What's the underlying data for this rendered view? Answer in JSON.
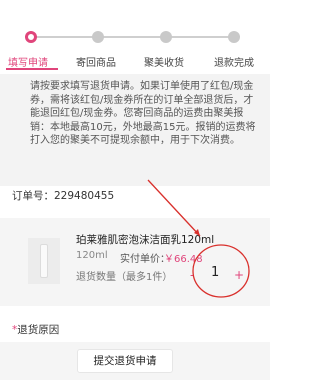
{
  "steps": [
    {
      "label": "填写申请",
      "active": true
    },
    {
      "label": "寄回商品",
      "active": false
    },
    {
      "label": "聚美收货",
      "active": false
    },
    {
      "label": "退款完成",
      "active": false
    }
  ],
  "notice": {
    "text": "请按要求填写退货申请。如果订单使用了红包/现金券，需将该红包/现金券所在的订单全部退货后，才能退回红包/现金券。您寄回商品的运费由聚美报销：本地最高10元，外地最高15元。报销的运费将打入您的聚美不可提现余额中，用于下次消费。"
  },
  "order": {
    "label": "订单号：",
    "number": "229480455"
  },
  "product": {
    "name": "珀莱雅肌密泡沫洁面乳120ml",
    "spec": "120ml",
    "paid_label": "实付单价：",
    "price": "￥66.48",
    "qty_label": "退货数量（最多1件）",
    "minus": "-",
    "quantity": "1",
    "plus": "+"
  },
  "reason": {
    "required_mark": "*",
    "label": "退货原因"
  },
  "submit": {
    "label": "提交退货申请"
  },
  "colors": {
    "accent": "#e0457b",
    "annotation": "#d9302c"
  }
}
